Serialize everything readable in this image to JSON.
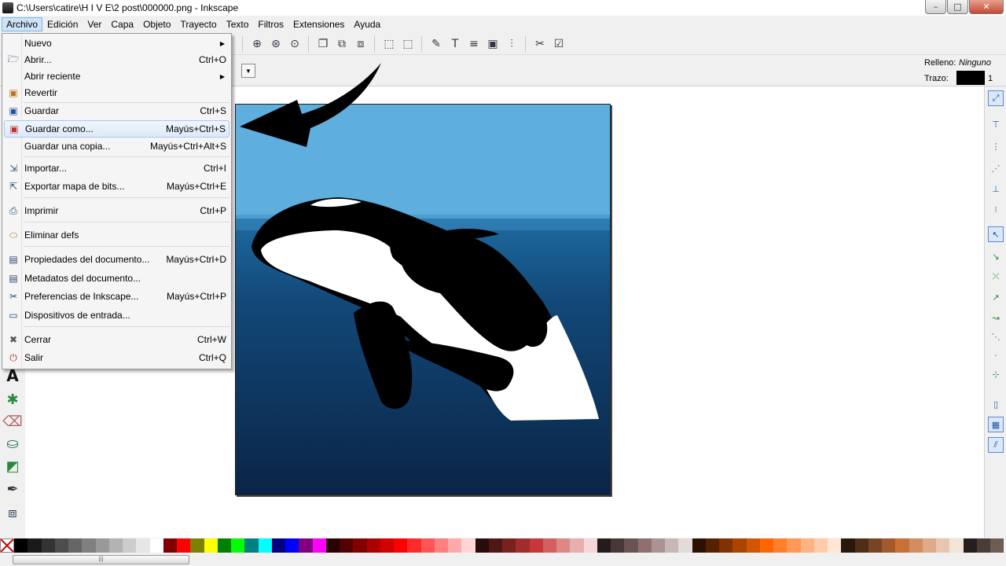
{
  "window": {
    "title": "C:\\Users\\catire\\H I V E\\2 post\\000000.png - Inkscape",
    "minimize": "–",
    "maximize": "□",
    "close": "✕"
  },
  "menubar": [
    "Archivo",
    "Edición",
    "Ver",
    "Capa",
    "Objeto",
    "Trayecto",
    "Texto",
    "Filtros",
    "Extensiones",
    "Ayuda"
  ],
  "file_menu": [
    {
      "label": "Nuevo",
      "shortcut": "",
      "icon": "",
      "submenu": true
    },
    {
      "label": "Abrir...",
      "shortcut": "Ctrl+O",
      "icon": "open-folder-icon"
    },
    {
      "label": "Abrir reciente",
      "shortcut": "",
      "icon": "",
      "submenu": true
    },
    {
      "label": "Revertir",
      "shortcut": "",
      "icon": "revert-icon"
    },
    {
      "label": "Guardar",
      "shortcut": "Ctrl+S",
      "icon": "save-icon"
    },
    {
      "label": "Guardar como...",
      "shortcut": "Mayús+Ctrl+S",
      "icon": "save-as-icon",
      "highlighted": true
    },
    {
      "label": "Guardar una copia...",
      "shortcut": "Mayús+Ctrl+Alt+S",
      "icon": ""
    },
    {
      "label": "Importar...",
      "shortcut": "Ctrl+I",
      "icon": "import-icon"
    },
    {
      "label": "Exportar mapa de bits...",
      "shortcut": "Mayús+Ctrl+E",
      "icon": "export-icon"
    },
    {
      "label": "Imprimir",
      "shortcut": "Ctrl+P",
      "icon": "print-icon"
    },
    {
      "label": "Eliminar defs",
      "shortcut": "",
      "icon": "vacuum-defs-icon"
    },
    {
      "label": "Propiedades del documento...",
      "shortcut": "Mayús+Ctrl+D",
      "icon": "document-properties-icon"
    },
    {
      "label": "Metadatos del documento...",
      "shortcut": "",
      "icon": "metadata-icon"
    },
    {
      "label": "Preferencias de Inkscape...",
      "shortcut": "Mayús+Ctrl+P",
      "icon": "preferences-icon"
    },
    {
      "label": "Dispositivos de entrada...",
      "shortcut": "",
      "icon": "input-devices-icon"
    },
    {
      "label": "Cerrar",
      "shortcut": "Ctrl+W",
      "icon": "close-icon"
    },
    {
      "label": "Salir",
      "shortcut": "Ctrl+Q",
      "icon": "quit-icon"
    }
  ],
  "style_indicator": {
    "fill_label": "Relleno:",
    "fill_value": "Ninguno",
    "stroke_label": "Trazo:",
    "stroke_width": "1",
    "stroke_color": "#000000"
  },
  "toolbox_glyphs": {
    "text_tool": "A"
  },
  "palette": [
    "#000000",
    "#1a1a1a",
    "#333333",
    "#4d4d4d",
    "#666666",
    "#808080",
    "#999999",
    "#b3b3b3",
    "#cccccc",
    "#e6e6e6",
    "#ffffff",
    "#800000",
    "#ff0000",
    "#808000",
    "#ffff00",
    "#008000",
    "#00ff00",
    "#008080",
    "#00ffff",
    "#000080",
    "#0000ff",
    "#800080",
    "#ff00ff",
    "#2b0000",
    "#550000",
    "#800000",
    "#aa0000",
    "#d40000",
    "#ff0000",
    "#ff2a2a",
    "#ff5555",
    "#ff8080",
    "#ffaaaa",
    "#ffd5d5",
    "#280b0b",
    "#501616",
    "#782121",
    "#a02c2c",
    "#c83737",
    "#d35f5f",
    "#de8787",
    "#e9afaf",
    "#f4d7d7",
    "#241c1c",
    "#483737",
    "#6c5353",
    "#916f6f",
    "#ac9393",
    "#c8b7b7",
    "#e3dbdb",
    "#2b1100",
    "#552200",
    "#803300",
    "#aa4400",
    "#d45500",
    "#ff6600",
    "#ff7f2a",
    "#ff9955",
    "#ffb380",
    "#ffccaa",
    "#ffe6d5",
    "#28170b",
    "#502d16",
    "#784421",
    "#a05a2c",
    "#c87137",
    "#d38d5f",
    "#deaa87",
    "#e9c6af",
    "#f4e3d7",
    "#241f1c",
    "#483e37",
    "#6c5d53"
  ],
  "colors": {
    "sky_top": "#5eaede",
    "sea_top": "#1a5a8e",
    "sea_bottom": "#0a2648",
    "menu_highlight": "#dce9f8"
  }
}
